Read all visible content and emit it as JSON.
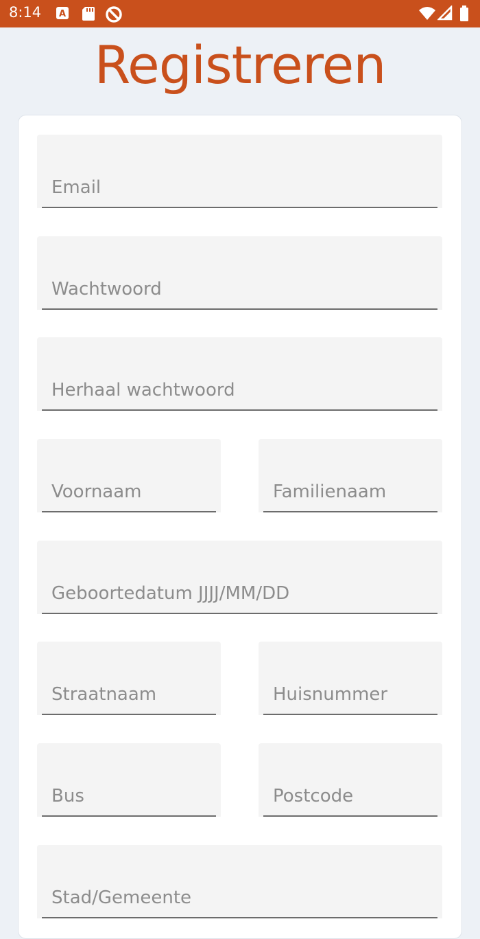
{
  "status_bar": {
    "time": "8:14",
    "left_icons": [
      "a-badge-icon",
      "sd-card-icon",
      "no-sync-icon"
    ],
    "right_icons": [
      "wifi-icon",
      "signal-icon",
      "battery-icon"
    ],
    "color": "#c9501c"
  },
  "page": {
    "title": "Registreren"
  },
  "form": {
    "email": "Email",
    "password": "Wachtwoord",
    "repeat_password": "Herhaal wachtwoord",
    "first_name": "Voornaam",
    "last_name": "Familienaam",
    "birthdate": "Geboortedatum JJJJ/MM/DD",
    "street": "Straatnaam",
    "house_number": "Huisnummer",
    "bus": "Bus",
    "postal_code": "Postcode",
    "city": "Stad/Gemeente"
  },
  "colors": {
    "accent": "#c9501c",
    "background": "#edf1f6",
    "field_bg": "#f4f4f4",
    "placeholder": "#8c8c8c"
  }
}
